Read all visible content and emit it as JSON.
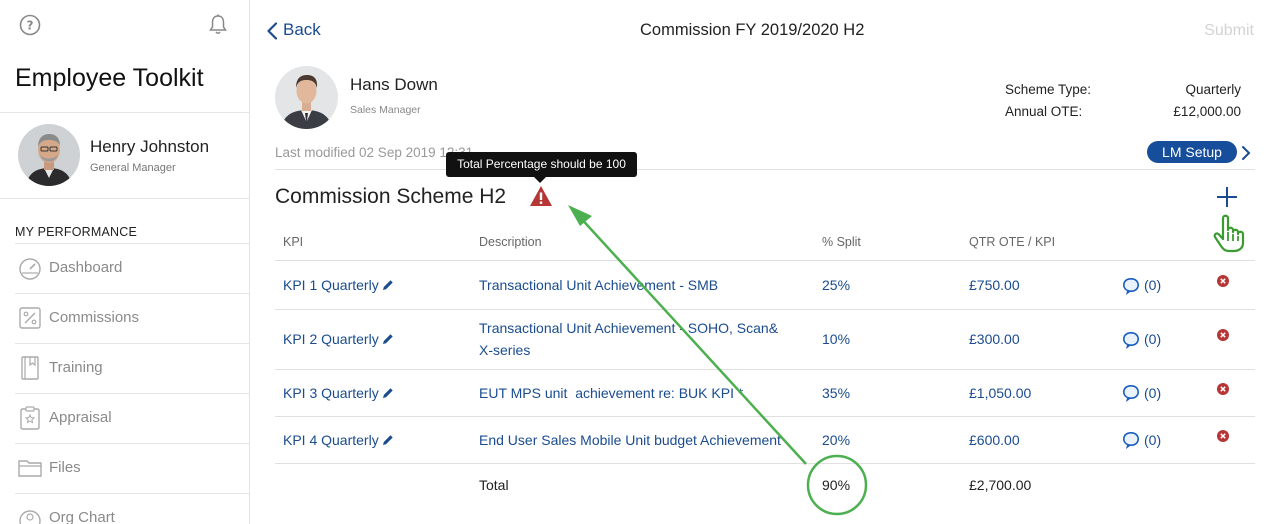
{
  "sidebar": {
    "app_title": "Employee Toolkit",
    "user": {
      "name": "Henry Johnston",
      "role": "General Manager"
    },
    "section_label": "MY PERFORMANCE",
    "items": [
      {
        "label": "Dashboard",
        "icon": "dashboard-icon"
      },
      {
        "label": "Commissions",
        "icon": "percent-icon"
      },
      {
        "label": "Training",
        "icon": "book-icon"
      },
      {
        "label": "Appraisal",
        "icon": "clipboard-icon"
      },
      {
        "label": "Files",
        "icon": "folder-icon"
      },
      {
        "label": "Org Chart",
        "icon": "org-chart-icon"
      }
    ]
  },
  "header": {
    "back_label": "Back",
    "title": "Commission FY 2019/2020 H2",
    "submit_label": "Submit"
  },
  "employee": {
    "name": "Hans Down",
    "role": "Sales Manager",
    "last_modified": "Last modified 02 Sep 2019 12:31",
    "scheme_type_label": "Scheme Type:",
    "scheme_type_value": "Quarterly",
    "annual_ote_label": "Annual OTE:",
    "annual_ote_value": "£12,000.00",
    "lm_setup_label": "LM Setup"
  },
  "tooltip": "Total Percentage should be 100",
  "scheme": {
    "title": "Commission Scheme H2",
    "columns": {
      "kpi": "KPI",
      "description": "Description",
      "split": "% Split",
      "ote": "QTR OTE / KPI"
    },
    "rows": [
      {
        "kpi": "KPI 1 Quarterly",
        "description": "Transactional Unit Achievement - SMB",
        "split": "25%",
        "ote": "£750.00",
        "comments": "(0)"
      },
      {
        "kpi": "KPI 2 Quarterly",
        "description": "Transactional Unit Achievement - SOHO, Scan&",
        "description2": "X-series",
        "split": "10%",
        "ote": "£300.00",
        "comments": "(0)"
      },
      {
        "kpi": "KPI 3 Quarterly",
        "description": "EUT MPS unit  achievement re: BUK KPI *",
        "split": "35%",
        "ote": "£1,050.00",
        "comments": "(0)"
      },
      {
        "kpi": "KPI 4 Quarterly",
        "description": "End User Sales Mobile Unit budget Achievement",
        "split": "20%",
        "ote": "£600.00",
        "comments": "(0)"
      }
    ],
    "total": {
      "label": "Total",
      "split": "90%",
      "ote": "£2,700.00"
    }
  },
  "colors": {
    "brand": "#1a4c8f",
    "button": "#174e9c",
    "warning": "#b63535",
    "annotation": "#4caf50"
  }
}
